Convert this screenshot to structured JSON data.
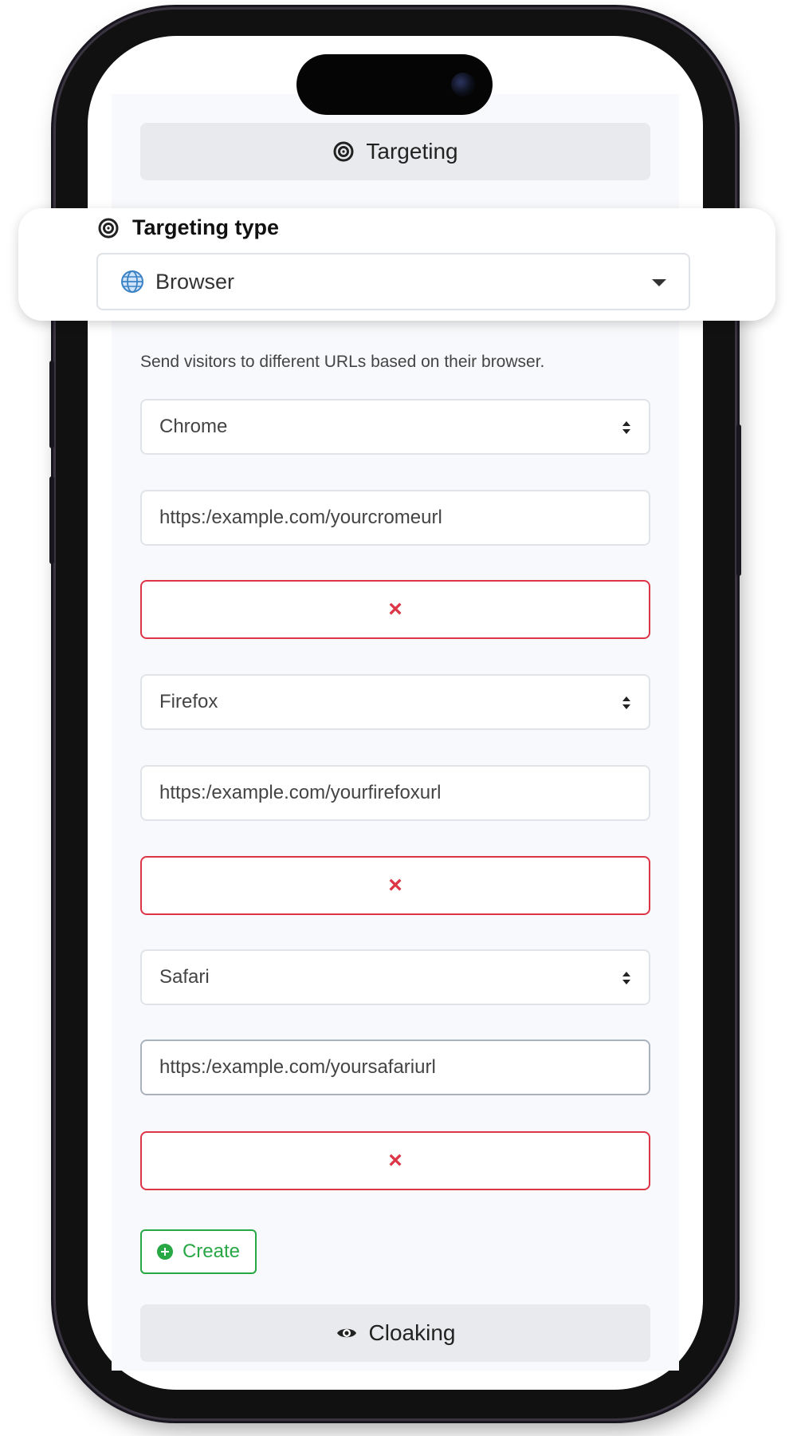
{
  "targeting_section": {
    "title": "Targeting",
    "icon": "target-icon"
  },
  "targeting_type": {
    "label": "Targeting type",
    "selected": "Browser",
    "icon": "globe-icon"
  },
  "description": "Send visitors to different URLs based on their browser.",
  "rules": [
    {
      "browser": "Chrome",
      "url": "https:/example.com/yourcromeurl",
      "remove_label": "×"
    },
    {
      "browser": "Firefox",
      "url": "https:/example.com/yourfirefoxurl",
      "remove_label": "×"
    },
    {
      "browser": "Safari",
      "url": "https:/example.com/yoursafariurl",
      "remove_label": "×"
    }
  ],
  "create_button": {
    "label": "Create",
    "icon": "plus-circle-icon"
  },
  "cloaking_section": {
    "title": "Cloaking",
    "icon": "eye-icon"
  },
  "colors": {
    "danger": "#dc3545",
    "success": "#28a745",
    "section_bg": "#e9eaed"
  }
}
